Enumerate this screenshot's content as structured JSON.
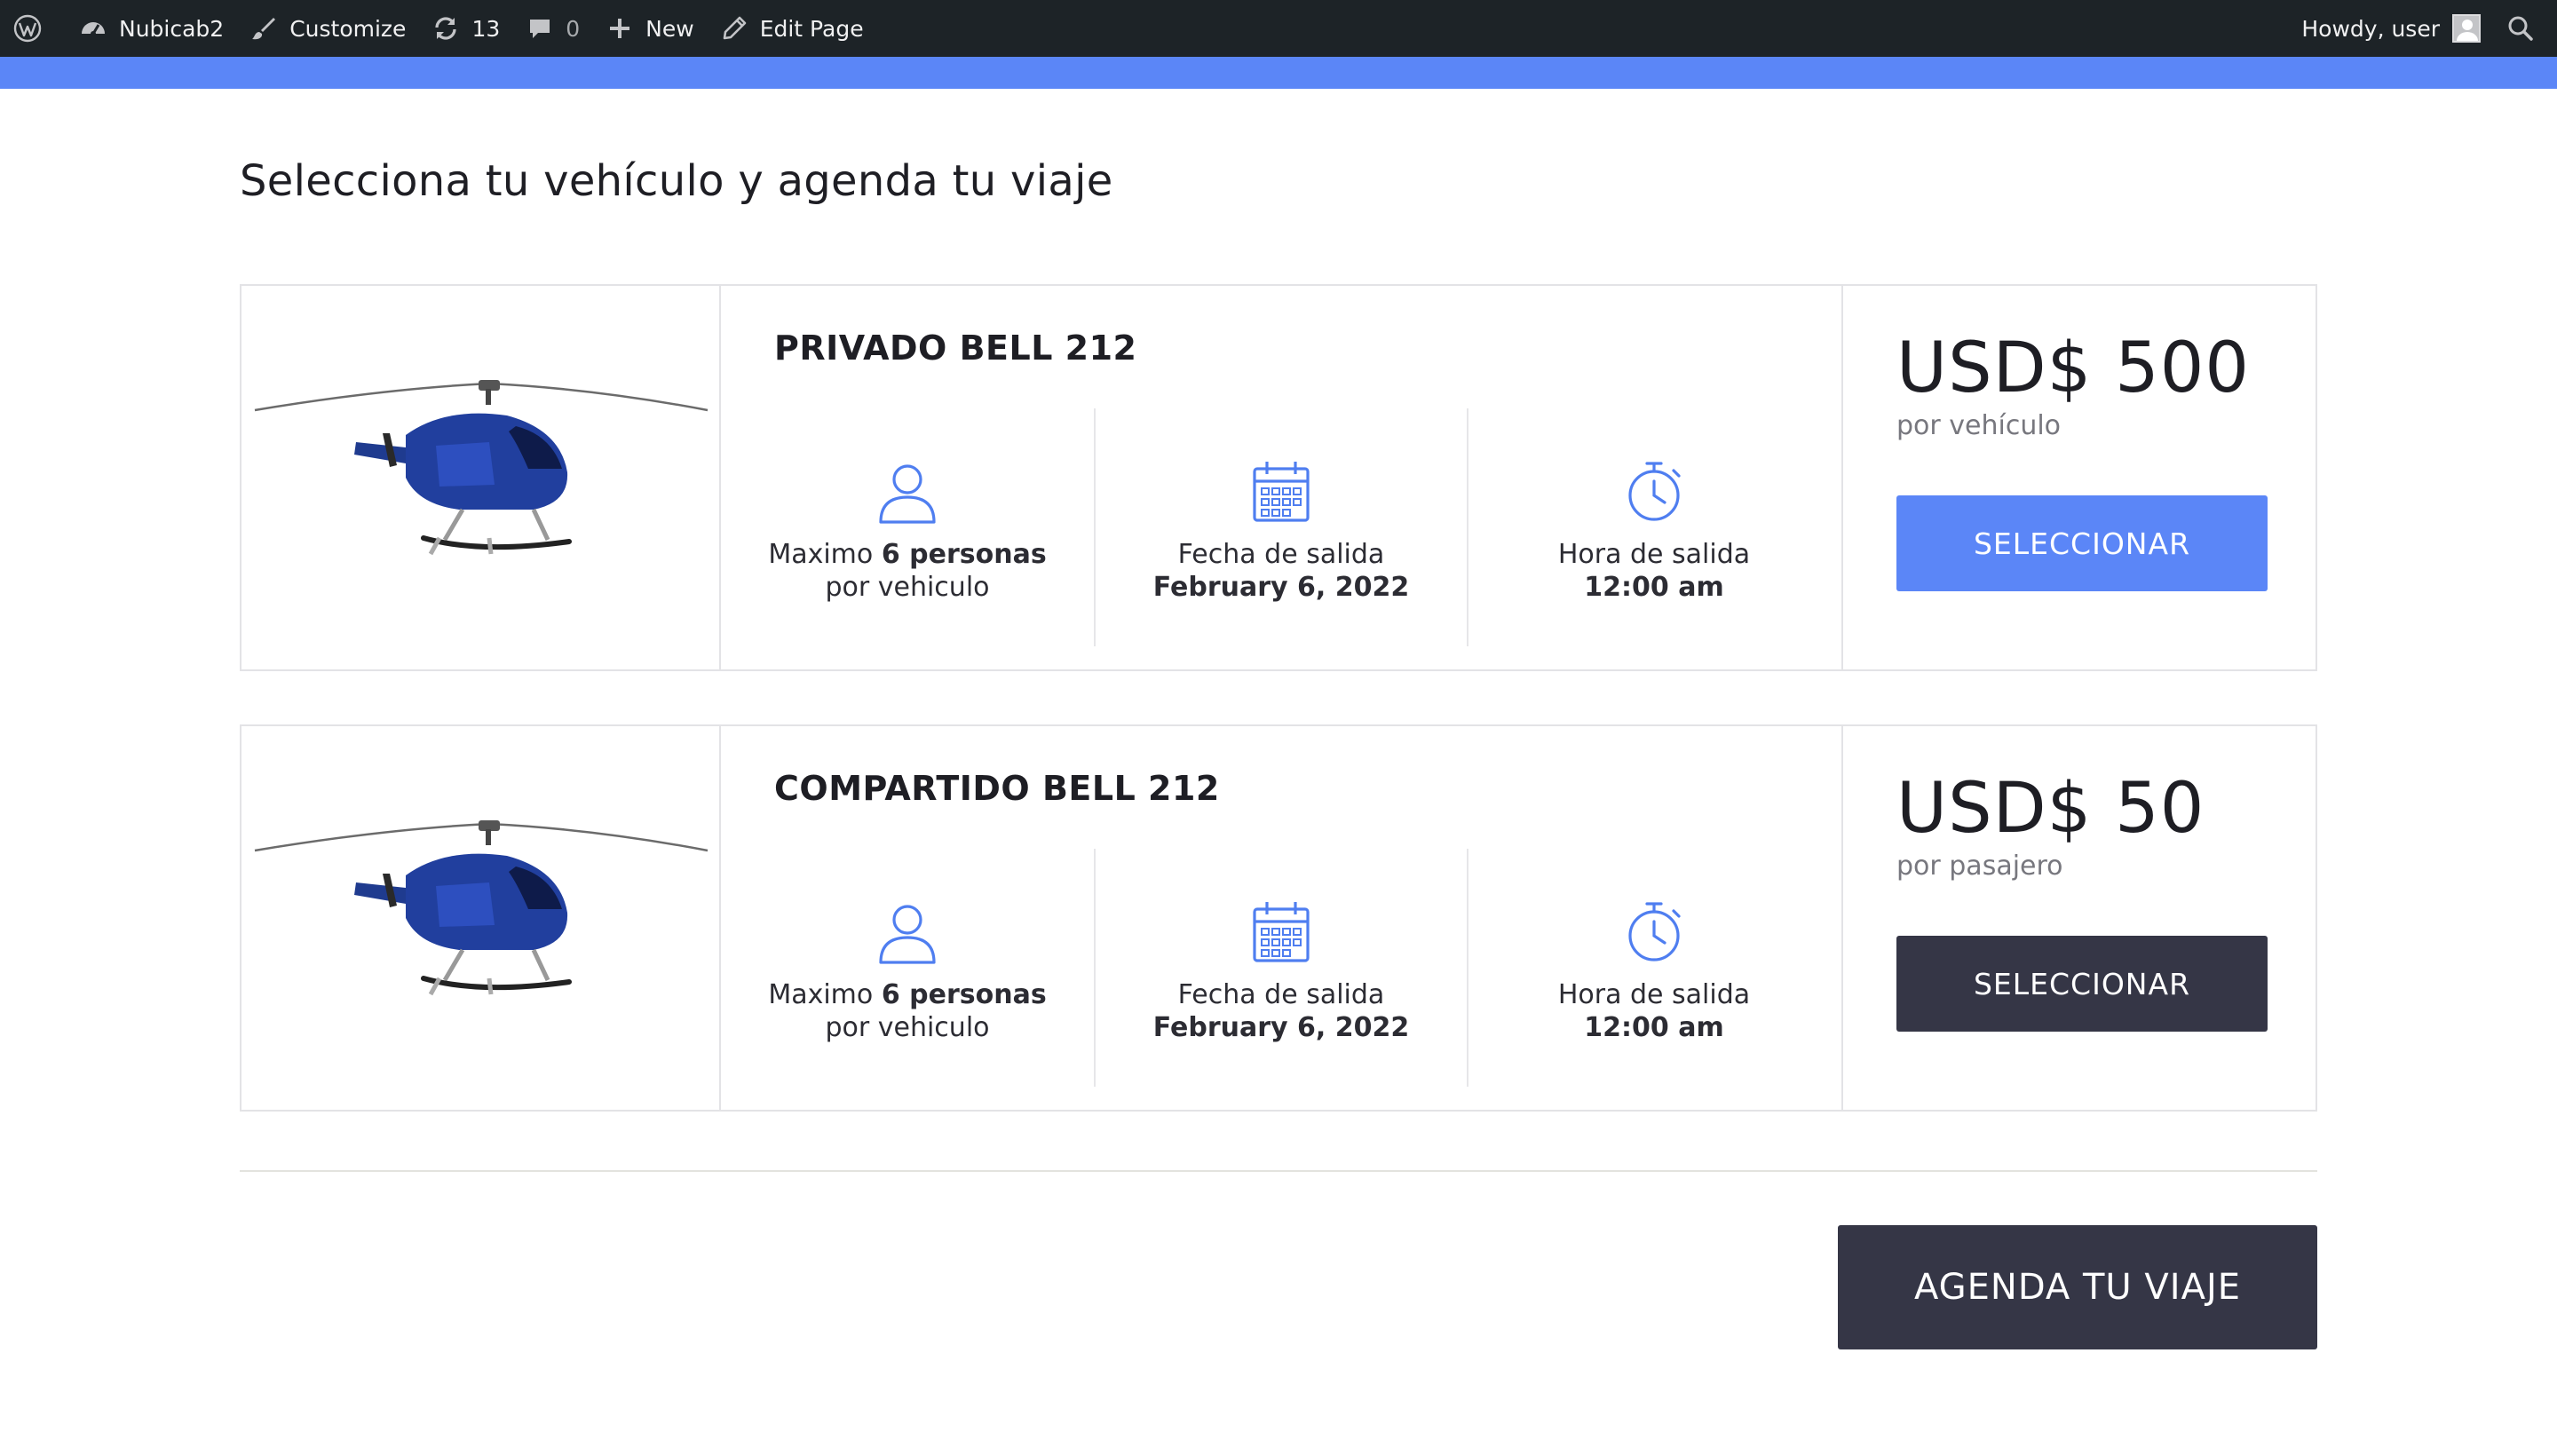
{
  "adminbar": {
    "site_name": "Nubicab2",
    "customize": "Customize",
    "updates_count": "13",
    "comments_count": "0",
    "new_label": "New",
    "edit_page": "Edit Page",
    "howdy": "Howdy, user"
  },
  "colors": {
    "adminbar_bg": "#1d2327",
    "accent": "#5b86f7",
    "dark_button": "#353646"
  },
  "page": {
    "title": "Selecciona tu vehículo y agenda tu viaje"
  },
  "vehicles": [
    {
      "name": "PRIVADO BELL 212",
      "capacity_prefix": "Maximo",
      "capacity_bold": "6 personas",
      "capacity_suffix": "por vehiculo",
      "date_label": "Fecha de salida",
      "date_value": "February 6, 2022",
      "time_label": "Hora de salida",
      "time_value": "12:00 am",
      "price": "USD$ 500",
      "price_unit": "por vehículo",
      "button": "SELECCIONAR"
    },
    {
      "name": "COMPARTIDO BELL 212",
      "capacity_prefix": "Maximo",
      "capacity_bold": "6 personas",
      "capacity_suffix": "por vehiculo",
      "date_label": "Fecha de salida",
      "date_value": "February 6, 2022",
      "time_label": "Hora de salida",
      "time_value": "12:00 am",
      "price": "USD$ 50",
      "price_unit": "por pasajero",
      "button": "SELECCIONAR"
    }
  ],
  "footer": {
    "agenda_button": "AGENDA TU VIAJE"
  },
  "icons": [
    "wordpress-icon",
    "dashboard-icon",
    "brush-icon",
    "refresh-icon",
    "comment-icon",
    "plus-icon",
    "pencil-icon",
    "search-icon",
    "user-icon",
    "calendar-icon",
    "stopwatch-icon",
    "helicopter-image"
  ]
}
